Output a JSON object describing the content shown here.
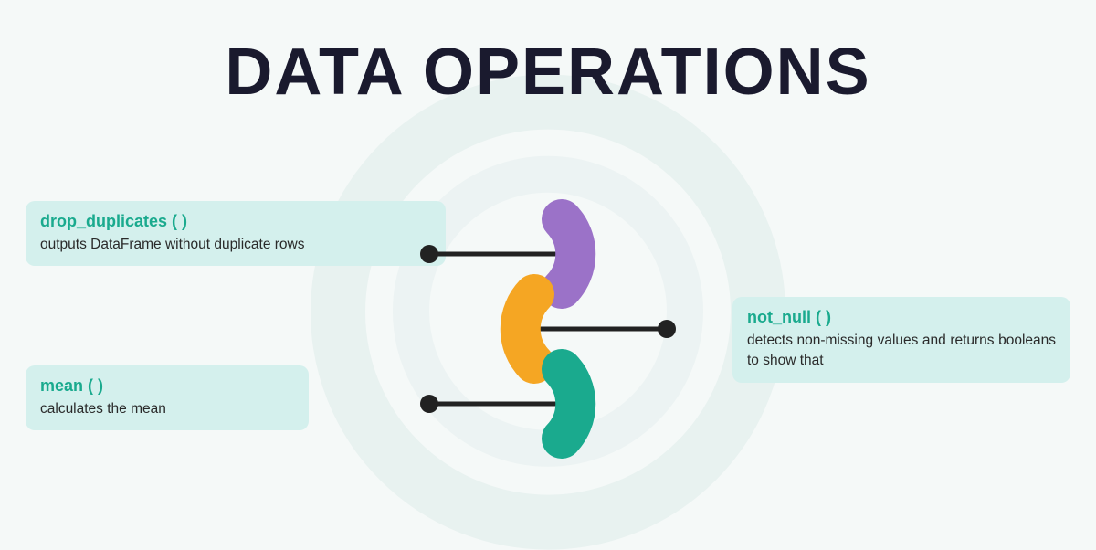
{
  "title": "DATA OPERATIONS",
  "cards": {
    "drop_duplicates": {
      "function_name": "drop_duplicates ( )",
      "description": "outputs  DataFrame  without duplicate rows"
    },
    "mean": {
      "function_name": "mean ( )",
      "description": "calculates the mean"
    },
    "not_null": {
      "function_name": "not_null ( )",
      "description": "detects  non-missing  values and  returns  booleans  to show that"
    }
  },
  "colors": {
    "teal": "#1aaa8e",
    "purple": "#9b72c8",
    "orange": "#f5a623",
    "dark_teal": "#1aaa8e",
    "card_bg": "#d4f0ed",
    "title": "#1a1a2e"
  }
}
